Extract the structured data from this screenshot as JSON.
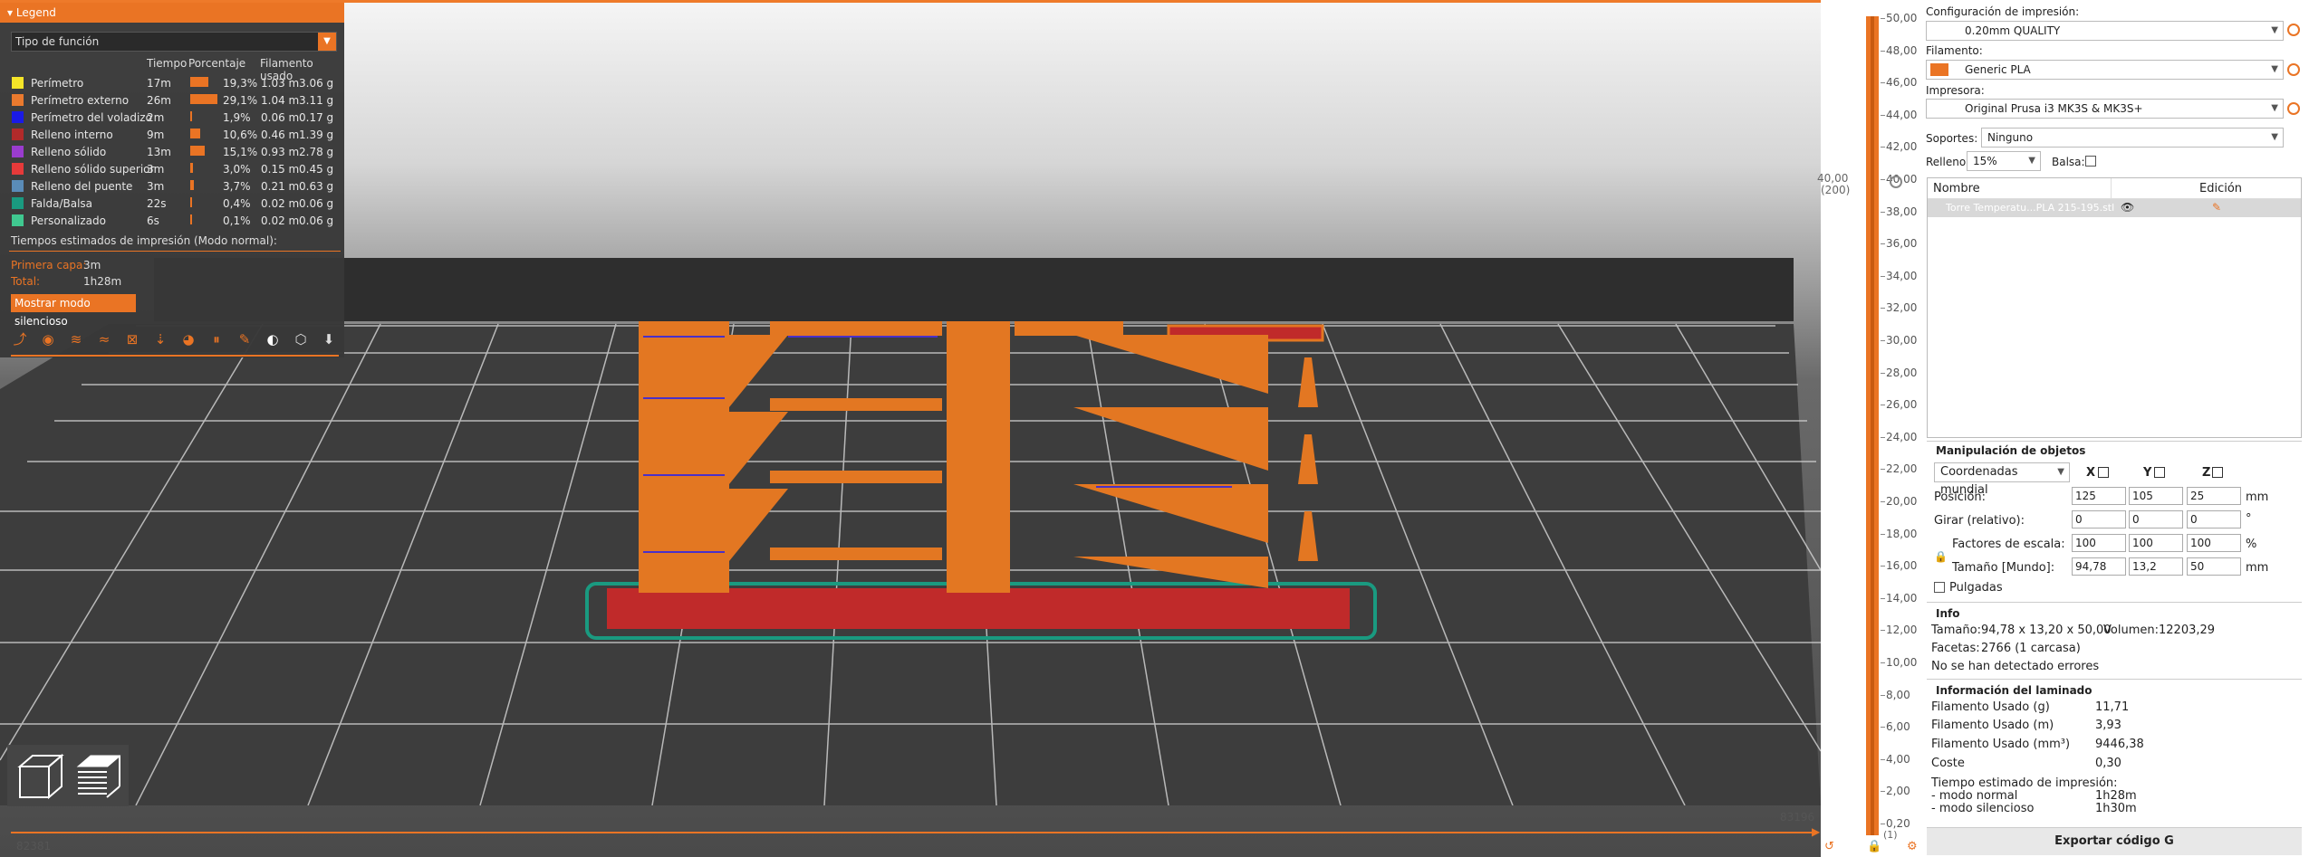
{
  "legend": {
    "title": "Legend",
    "feature_type": "Tipo de función",
    "columns": [
      "Tiempo",
      "Porcentaje",
      "Filamento usado"
    ],
    "rows": [
      {
        "name": "Perímetro",
        "color": "#f5e528",
        "time": "17m",
        "percent": "19,3%",
        "pct": 19.3,
        "m": "1.03 m",
        "g": "3.06 g"
      },
      {
        "name": "Perímetro externo",
        "color": "#ea7a2e",
        "time": "26m",
        "percent": "29,1%",
        "pct": 29.1,
        "m": "1.04 m",
        "g": "3.11 g"
      },
      {
        "name": "Perímetro del voladizo",
        "color": "#1a1ae6",
        "time": "2m",
        "percent": "1,9%",
        "pct": 1.9,
        "m": "0.06 m",
        "g": "0.17 g"
      },
      {
        "name": "Relleno interno",
        "color": "#b22a2a",
        "time": "9m",
        "percent": "10,6%",
        "pct": 10.6,
        "m": "0.46 m",
        "g": "1.39 g"
      },
      {
        "name": "Relleno sólido",
        "color": "#9a3ccf",
        "time": "13m",
        "percent": "15,1%",
        "pct": 15.1,
        "m": "0.93 m",
        "g": "2.78 g"
      },
      {
        "name": "Relleno sólido superior",
        "color": "#e63a3a",
        "time": "3m",
        "percent": "3,0%",
        "pct": 3.0,
        "m": "0.15 m",
        "g": "0.45 g"
      },
      {
        "name": "Relleno del puente",
        "color": "#5a8cb8",
        "time": "3m",
        "percent": "3,7%",
        "pct": 3.7,
        "m": "0.21 m",
        "g": "0.63 g"
      },
      {
        "name": "Falda/Balsa",
        "color": "#1a9a80",
        "time": "22s",
        "percent": "0,4%",
        "pct": 0.4,
        "m": "0.02 m",
        "g": "0.06 g"
      },
      {
        "name": "Personalizado",
        "color": "#40c890",
        "time": "6s",
        "percent": "0,1%",
        "pct": 0.1,
        "m": "0.02 m",
        "g": "0.06 g"
      }
    ],
    "estimated_title": "Tiempos estimados de impresión (Modo normal):",
    "first_layer_label": "Primera capa:",
    "first_layer_value": "3m",
    "total_label": "Total:",
    "total_value": "1h28m",
    "silent_button": "Mostrar modo silencioso"
  },
  "slider": {
    "ticks": [
      "50,00",
      "48,00",
      "46,00",
      "44,00",
      "42,00",
      "40,00",
      "38,00",
      "36,00",
      "34,00",
      "32,00",
      "30,00",
      "28,00",
      "26,00",
      "24,00",
      "22,00",
      "20,00",
      "18,00",
      "16,00",
      "14,00",
      "12,00",
      "10,00",
      "8,00",
      "6,00",
      "4,00",
      "2,00",
      "0,20"
    ],
    "top_value": "40,00",
    "top_layer": "(200)",
    "bottom_layer": "(1)",
    "h_left": "82381",
    "h_right": "83196"
  },
  "sidebar": {
    "print_config_label": "Configuración de impresión:",
    "print_config_value": "0.20mm QUALITY",
    "filament_label": "Filamento:",
    "filament_value": "Generic PLA",
    "filament_color": "#ea7424",
    "printer_label": "Impresora:",
    "printer_value": "Original Prusa i3 MK3S & MK3S+",
    "supports_label": "Soportes:",
    "supports_value": "Ninguno",
    "infill_label": "Relleno:",
    "infill_value": "15%",
    "brim_label": "Balsa:",
    "list_col_name": "Nombre",
    "list_col_edit": "Edición",
    "object_name": "Torre Temperatu...PLA 215-195.stl"
  },
  "manip": {
    "title": "Manipulación de objetos",
    "coords": "Coordenadas mundial",
    "axes": [
      "X",
      "Y",
      "Z"
    ],
    "position_label": "Posición:",
    "position": [
      "125",
      "105",
      "25"
    ],
    "position_unit": "mm",
    "rotate_label": "Girar (relativo):",
    "rotate": [
      "0",
      "0",
      "0"
    ],
    "rotate_unit": "°",
    "scale_label": "Factores de escala:",
    "scale": [
      "100",
      "100",
      "100"
    ],
    "scale_unit": "%",
    "size_label": "Tamaño [Mundo]:",
    "size": [
      "94,78",
      "13,2",
      "50"
    ],
    "size_unit": "mm",
    "inches_label": "Pulgadas"
  },
  "info": {
    "title": "Info",
    "size_label": "Tamaño:",
    "size_value": "94,78 x 13,20 x 50,00",
    "volume_label": "Volumen:",
    "volume_value": "12203,29",
    "facets_label": "Facetas:",
    "facets_value": "2766 (1 carcasa)",
    "errors": "No se han detectado errores"
  },
  "slice": {
    "title": "Información del laminado",
    "rows": [
      {
        "label": "Filamento Usado (g)",
        "value": "11,71"
      },
      {
        "label": "Filamento Usado (m)",
        "value": "3,93"
      },
      {
        "label": "Filamento Usado (mm³)",
        "value": "9446,38"
      },
      {
        "label": "Coste",
        "value": "0,30"
      }
    ],
    "time_label": "Tiempo estimado de impresión:",
    "normal_label": "- modo normal",
    "normal_value": "1h28m",
    "silent_label": "- modo silencioso",
    "silent_value": "1h30m"
  },
  "export_button": "Exportar código G"
}
